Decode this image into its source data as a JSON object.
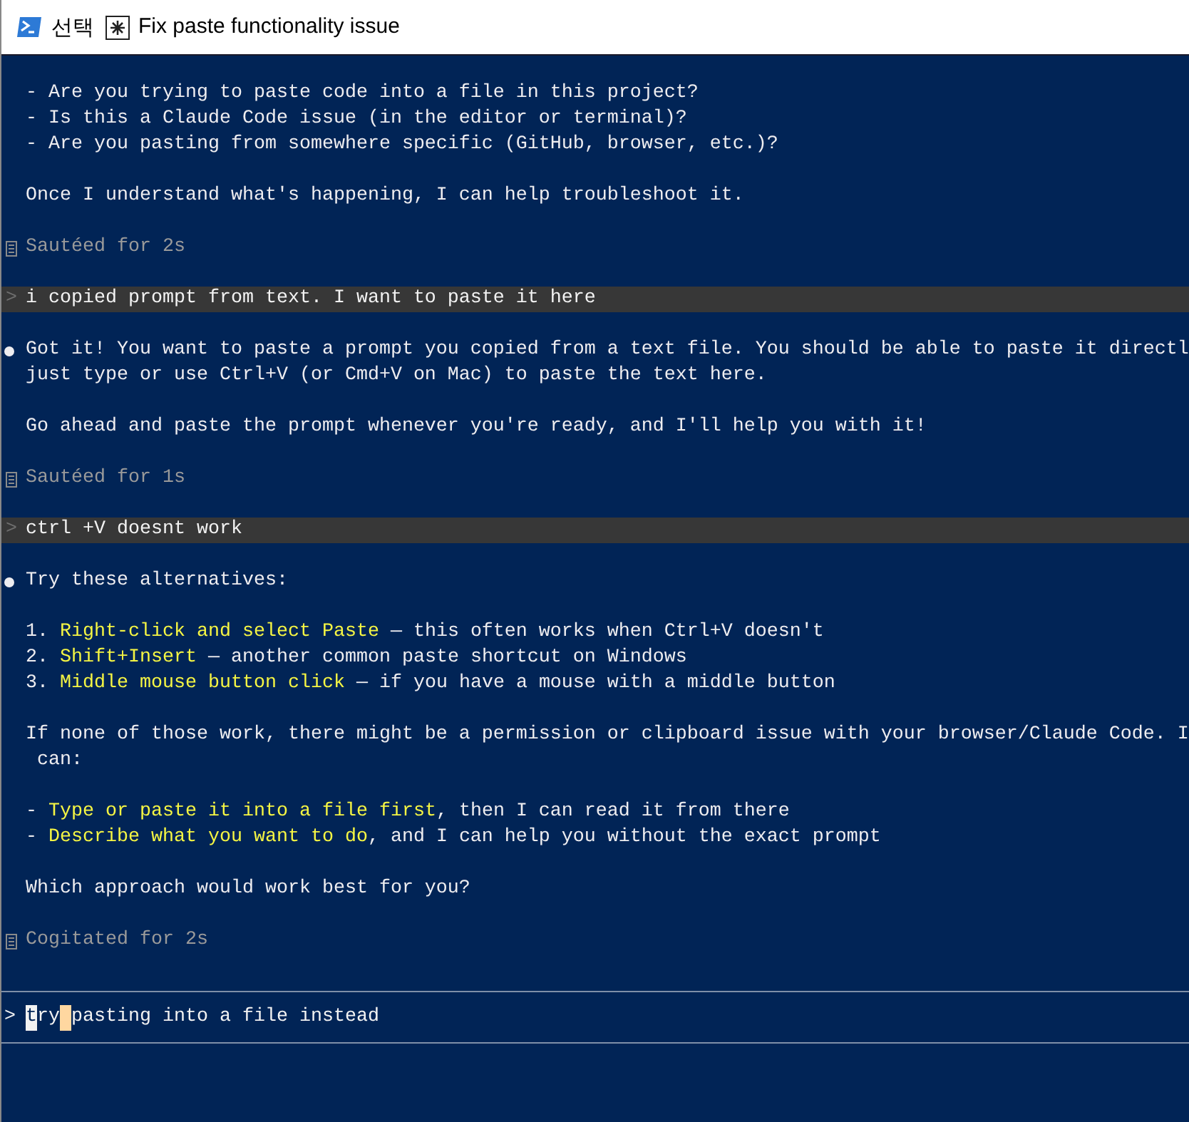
{
  "title_bar": {
    "mode": "선택",
    "title": "Fix paste functionality issue"
  },
  "transcript": [
    {
      "kind": "text",
      "bullet": false,
      "parts": [
        {
          "text": "- Are you trying to paste code into a file in this project?",
          "highlight": false
        }
      ]
    },
    {
      "kind": "text",
      "bullet": false,
      "parts": [
        {
          "text": "- Is this a Claude Code issue (in the editor or terminal)?",
          "highlight": false
        }
      ]
    },
    {
      "kind": "text",
      "bullet": false,
      "parts": [
        {
          "text": "- Are you pasting from somewhere specific (GitHub, browser, etc.)?",
          "highlight": false
        }
      ]
    },
    {
      "kind": "blank"
    },
    {
      "kind": "text",
      "bullet": false,
      "parts": [
        {
          "text": "Once I understand what's happening, I can help troubleshoot it.",
          "highlight": false
        }
      ]
    },
    {
      "kind": "blank"
    },
    {
      "kind": "status",
      "text": "Sautéed for 2s"
    },
    {
      "kind": "blank"
    },
    {
      "kind": "user",
      "prompt": ">",
      "text": "i copied prompt from text. I want to paste it here"
    },
    {
      "kind": "blank"
    },
    {
      "kind": "text",
      "bullet": true,
      "parts": [
        {
          "text": "Got it! You want to paste a prompt you copied from a text file. You should be able to paste it directl",
          "highlight": false
        }
      ]
    },
    {
      "kind": "text",
      "bullet": false,
      "parts": [
        {
          "text": "just type or use Ctrl+V (or Cmd+V on Mac) to paste the text here.",
          "highlight": false
        }
      ]
    },
    {
      "kind": "blank"
    },
    {
      "kind": "text",
      "bullet": false,
      "parts": [
        {
          "text": "Go ahead and paste the prompt whenever you're ready, and I'll help you with it!",
          "highlight": false
        }
      ]
    },
    {
      "kind": "blank"
    },
    {
      "kind": "status",
      "text": "Sautéed for 1s"
    },
    {
      "kind": "blank"
    },
    {
      "kind": "user",
      "prompt": ">",
      "text": "ctrl +V doesnt work"
    },
    {
      "kind": "blank"
    },
    {
      "kind": "text",
      "bullet": true,
      "parts": [
        {
          "text": "Try these alternatives:",
          "highlight": false
        }
      ]
    },
    {
      "kind": "blank"
    },
    {
      "kind": "text",
      "bullet": false,
      "parts": [
        {
          "text": "1. ",
          "highlight": false
        },
        {
          "text": "Right-click and select Paste",
          "highlight": true
        },
        {
          "text": " — this often works when Ctrl+V doesn't",
          "highlight": false
        }
      ]
    },
    {
      "kind": "text",
      "bullet": false,
      "parts": [
        {
          "text": "2. ",
          "highlight": false
        },
        {
          "text": "Shift+Insert",
          "highlight": true
        },
        {
          "text": " — another common paste shortcut on Windows",
          "highlight": false
        }
      ]
    },
    {
      "kind": "text",
      "bullet": false,
      "parts": [
        {
          "text": "3. ",
          "highlight": false
        },
        {
          "text": "Middle mouse button click",
          "highlight": true
        },
        {
          "text": " — if you have a mouse with a middle button",
          "highlight": false
        }
      ]
    },
    {
      "kind": "blank"
    },
    {
      "kind": "text",
      "bullet": false,
      "parts": [
        {
          "text": "If none of those work, there might be a permission or clipboard issue with your browser/Claude Code. I",
          "highlight": false
        }
      ]
    },
    {
      "kind": "continuation",
      "text": "can:"
    },
    {
      "kind": "blank"
    },
    {
      "kind": "text",
      "bullet": false,
      "parts": [
        {
          "text": "- ",
          "highlight": false
        },
        {
          "text": "Type or paste it into a file first",
          "highlight": true
        },
        {
          "text": ", then I can read it from there",
          "highlight": false
        }
      ]
    },
    {
      "kind": "text",
      "bullet": false,
      "parts": [
        {
          "text": "- ",
          "highlight": false
        },
        {
          "text": "Describe what you want to do",
          "highlight": true
        },
        {
          "text": ", and I can help you without the exact prompt",
          "highlight": false
        }
      ]
    },
    {
      "kind": "blank"
    },
    {
      "kind": "text",
      "bullet": false,
      "parts": [
        {
          "text": "Which approach would work best for you?",
          "highlight": false
        }
      ]
    },
    {
      "kind": "blank"
    },
    {
      "kind": "status",
      "text": "Cogitated for 2s"
    },
    {
      "kind": "blank"
    }
  ],
  "input": {
    "prompt": ">",
    "parts": [
      {
        "text": "t",
        "kind": "cursor"
      },
      {
        "text": "ry",
        "kind": "plain"
      },
      {
        "kind": "mark"
      },
      {
        "text": "pasting into a file instead",
        "kind": "plain"
      }
    ]
  }
}
